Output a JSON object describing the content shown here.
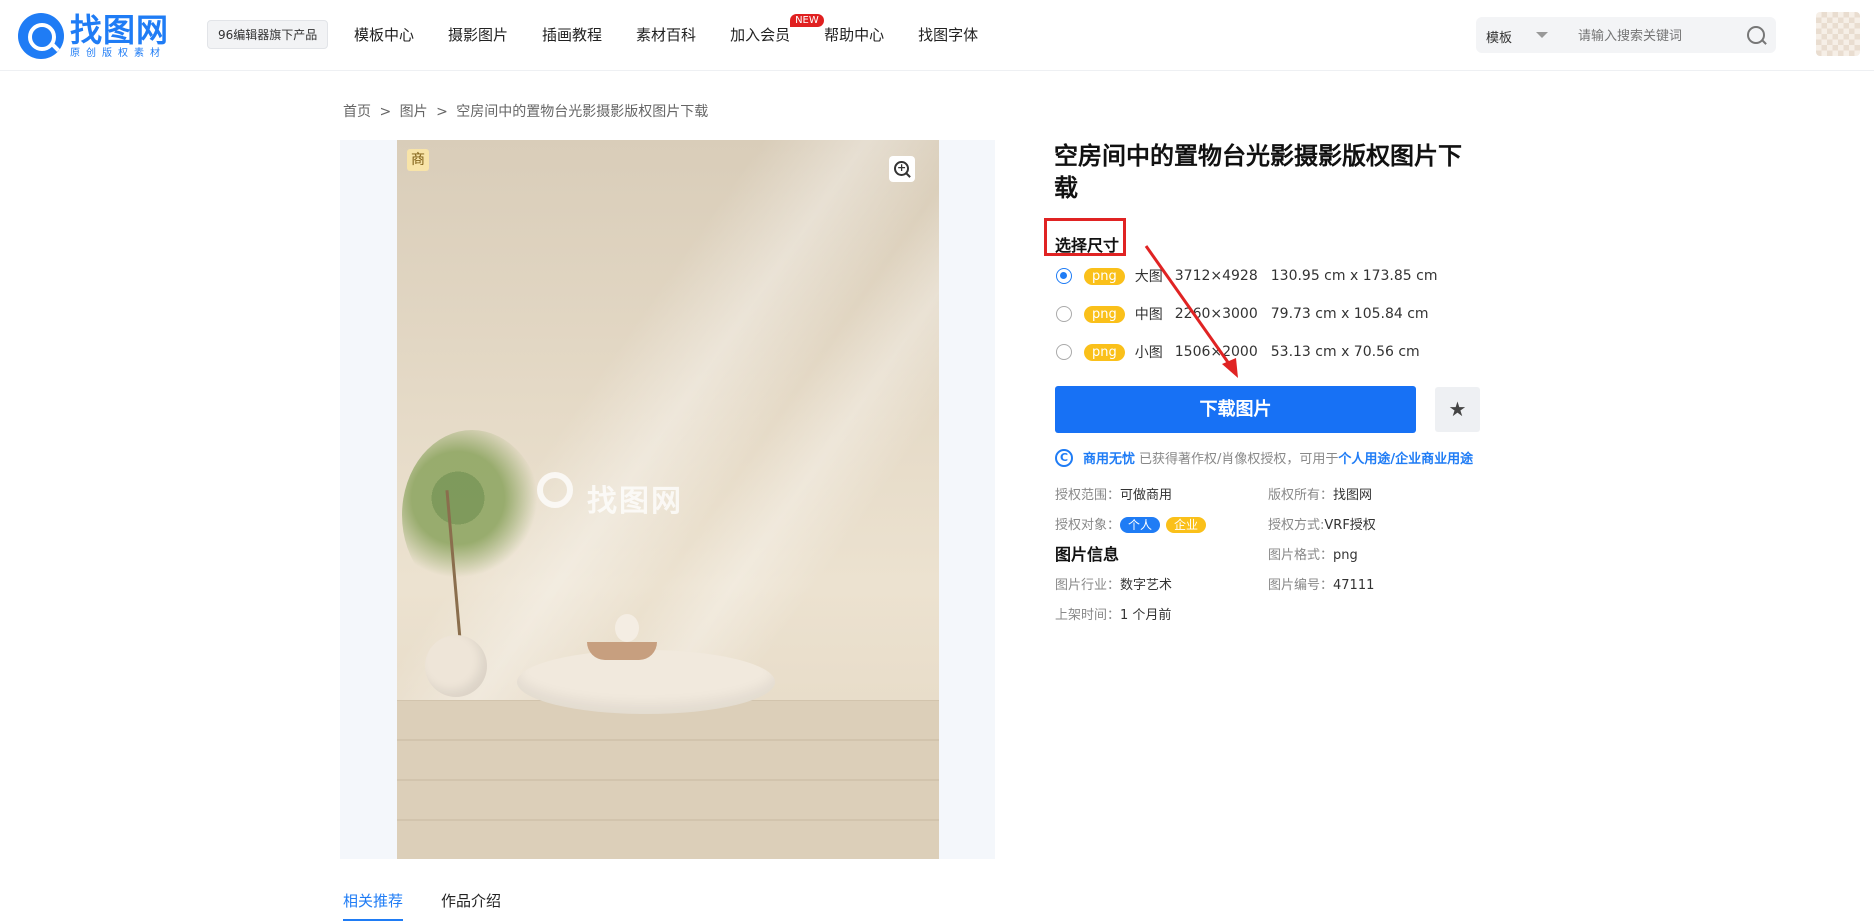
{
  "header": {
    "logo": {
      "name": "找图网",
      "subtitle": "原创版权素材"
    },
    "badge": "96编辑器旗下产品",
    "nav": [
      {
        "label": "模板中心"
      },
      {
        "label": "摄影图片"
      },
      {
        "label": "插画教程"
      },
      {
        "label": "素材百科"
      },
      {
        "label": "加入会员",
        "badge": "NEW"
      },
      {
        "label": "帮助中心"
      },
      {
        "label": "找图字体"
      }
    ],
    "search": {
      "type": "模板",
      "placeholder": "请输入搜索关键词"
    }
  },
  "breadcrumb": [
    "首页",
    ">",
    "图片",
    ">",
    "空房间中的置物台光影摄影版权图片下载"
  ],
  "image": {
    "commercial_tag": "商",
    "watermark": "找图网"
  },
  "detail": {
    "title": "空房间中的置物台光影摄影版权图片下载",
    "size_label": "选择尺寸",
    "sizes": [
      {
        "format": "png",
        "name": "大图",
        "px": "3712×4928",
        "cm": "130.95 cm x 173.85 cm",
        "selected": true
      },
      {
        "format": "png",
        "name": "中图",
        "px": "2260×3000",
        "cm": "79.73 cm x 105.84 cm",
        "selected": false
      },
      {
        "format": "png",
        "name": "小图",
        "px": "1506×2000",
        "cm": "53.13 cm x 70.56 cm",
        "selected": false
      }
    ],
    "download_label": "下载图片",
    "favorite_icon": "star-icon",
    "license": {
      "strong": "商用无忧",
      "text": "已获得著作权/肖像权授权，可用于",
      "link": "个人用途/企业商业用途"
    },
    "info": {
      "scope_label": "授权范围：",
      "scope_value": "可做商用",
      "owner_label": "版权所有：",
      "owner_value": "找图网",
      "object_label": "授权对象：",
      "object_tags": [
        "个人",
        "企业"
      ],
      "method_label": "授权方式:",
      "method_value": "VRF授权",
      "section_title": "图片信息",
      "format_label": "图片格式：",
      "format_value": "png",
      "industry_label": "图片行业：",
      "industry_value": "数字艺术",
      "id_label": "图片编号：",
      "id_value": "47111",
      "time_label": "上架时间：",
      "time_value": "1 个月前"
    }
  },
  "tabs": [
    {
      "label": "相关推荐",
      "active": true
    },
    {
      "label": "作品介绍",
      "active": false
    }
  ],
  "colors": {
    "primary": "#1771f5",
    "accent_yellow": "#fac01a",
    "highlight_red": "#e02323"
  }
}
